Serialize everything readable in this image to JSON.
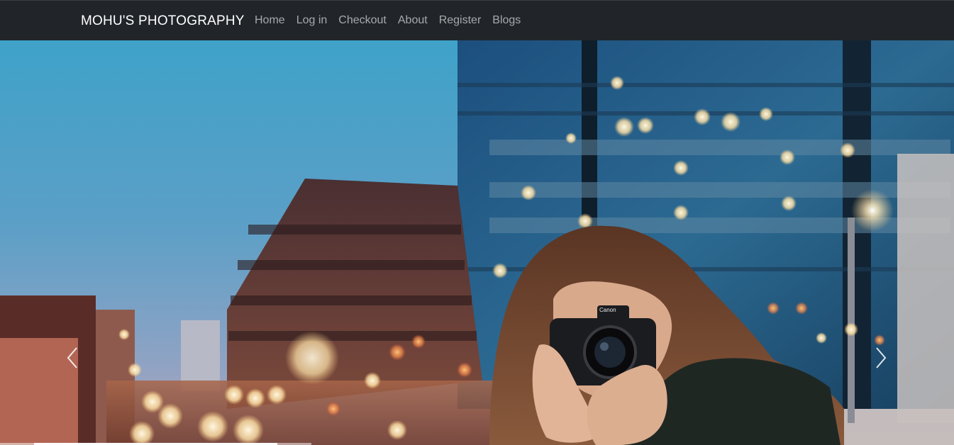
{
  "navbar": {
    "brand": "MOHU'S PHOTOGRAPHY",
    "links": [
      {
        "label": "Home"
      },
      {
        "label": "Log in"
      },
      {
        "label": "Checkout"
      },
      {
        "label": "About"
      },
      {
        "label": "Register"
      },
      {
        "label": "Blogs"
      }
    ]
  },
  "carousel": {
    "slide_image": "photographer-with-canon-camera-city-night",
    "camera_brand": "Canon",
    "prev_icon": "chevron-left-icon",
    "next_icon": "chevron-right-icon",
    "slide_count": 3,
    "active_slide": 1
  },
  "colors": {
    "navbar_bg": "#212529",
    "brand_text": "#ffffff",
    "nav_link_text": "#9a9da0"
  }
}
